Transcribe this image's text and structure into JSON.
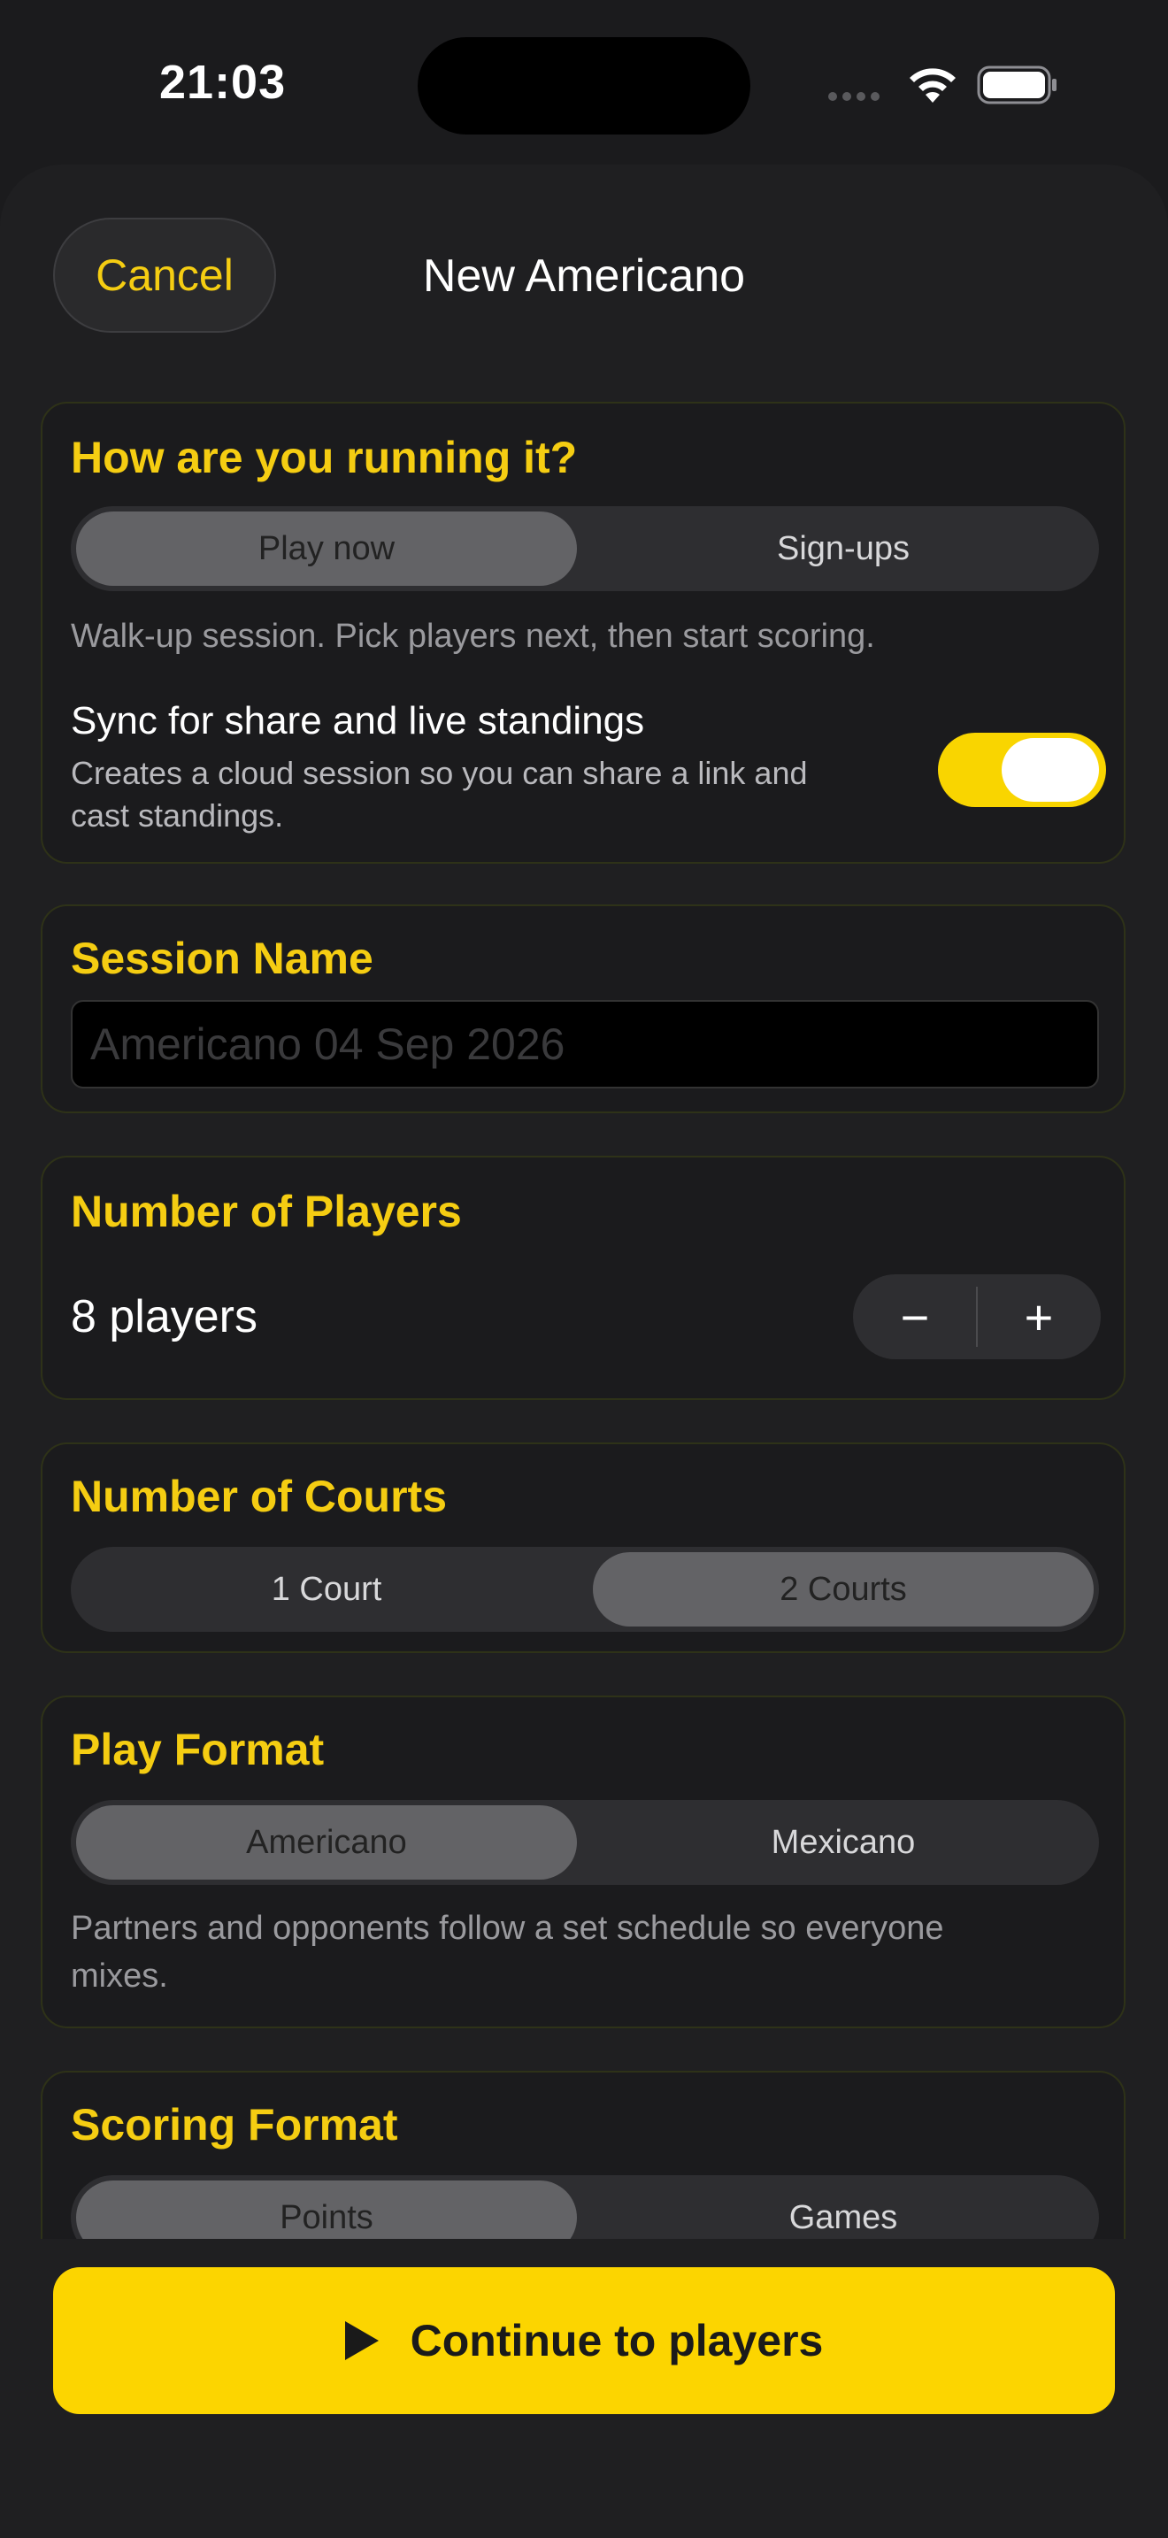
{
  "status_bar": {
    "time": "21:03"
  },
  "nav": {
    "cancel_label": "Cancel",
    "title": "New Americano"
  },
  "run_mode": {
    "title": "How are you running it?",
    "options": [
      "Play now",
      "Sign-ups"
    ],
    "selected": "Play now",
    "helper": "Walk-up session. Pick players next, then start scoring.",
    "sync_title": "Sync for share and live standings",
    "sync_subtitle": "Creates a cloud session so you can share a link and cast standings.",
    "sync_on": true
  },
  "session_name": {
    "title": "Session Name",
    "value": "",
    "placeholder": "Americano 04 Sep 2026"
  },
  "players": {
    "title": "Number of Players",
    "value_label": "8 players",
    "minus": "−",
    "plus": "+"
  },
  "courts": {
    "title": "Number of Courts",
    "options": [
      "1 Court",
      "2 Courts"
    ],
    "selected": "2 Courts"
  },
  "play_format": {
    "title": "Play Format",
    "options": [
      "Americano",
      "Mexicano"
    ],
    "selected": "Americano",
    "helper": "Partners and opponents follow a set schedule so everyone mixes."
  },
  "scoring_format": {
    "title": "Scoring Format",
    "options": [
      "Points",
      "Games"
    ],
    "selected": "Points"
  },
  "footer": {
    "continue_label": "Continue to players"
  },
  "colors": {
    "accent": "#f5cd12",
    "background": "#1b1b1d",
    "button": "#fcd500"
  }
}
